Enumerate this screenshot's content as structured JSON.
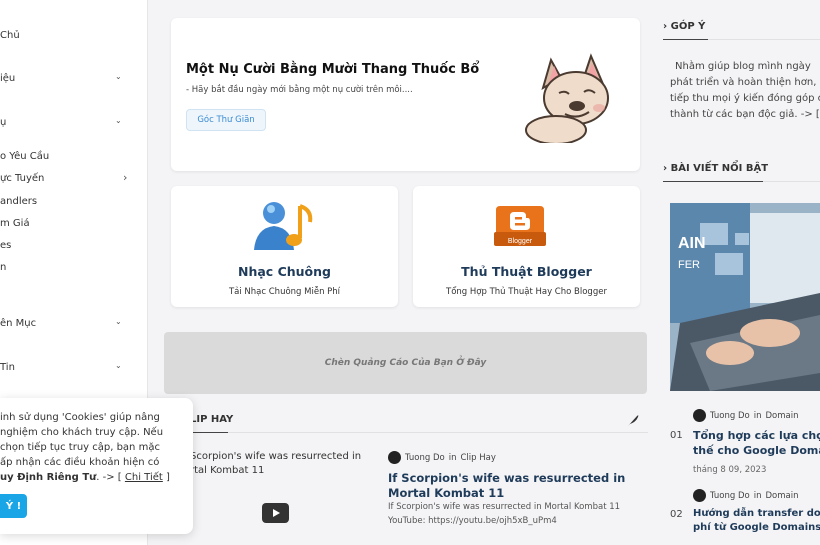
{
  "sidebar": {
    "items": [
      {
        "label": "Chủ",
        "chevron": ""
      },
      {
        "label": "iệu",
        "chevron": "⌄"
      },
      {
        "label": "ụ",
        "chevron": "⌄"
      },
      {
        "label": "o Yêu Cầu",
        "chevron": ""
      },
      {
        "label": "ực Tuyến",
        "chevron": "›"
      },
      {
        "label": "andlers",
        "chevron": ""
      },
      {
        "label": "m Giá",
        "chevron": ""
      },
      {
        "label": "es",
        "chevron": ""
      },
      {
        "label": "n",
        "chevron": ""
      },
      {
        "label": "ên Mục",
        "chevron": "⌄"
      },
      {
        "label": "Tin",
        "chevron": "⌄"
      }
    ]
  },
  "hero": {
    "title": "Một Nụ Cười Bằng Mười Thang Thuốc Bổ",
    "subtitle": "- Hãy bắt đầu ngày mới bằng một nụ cười trên môi....",
    "tag": "Góc Thư Giãn"
  },
  "features": [
    {
      "title": "Nhạc Chuông",
      "subtitle": "Tải Nhạc Chuông Miễn Phí",
      "icon": "user-music-icon"
    },
    {
      "title": "Thủ Thuật Blogger",
      "subtitle": "Tổng Hợp Thủ Thuật Hay Cho Blogger",
      "icon": "blogger-icon"
    }
  ],
  "ad": {
    "text": "Chèn Quảng Cáo Của Bạn Ở Đây"
  },
  "clip_section": {
    "heading": "LIP HAY",
    "left_post_text": [
      "Scorpion's wife was resurrected in",
      "rtal Kombat 11"
    ],
    "post": {
      "author": "Tuong Do",
      "in_word": "in",
      "category": "Clip Hay",
      "title": "If Scorpion's wife was resurrected in Mortal Kombat 11",
      "excerpt_1": "If Scorpion's wife was resurrected in Mortal Kombat 11",
      "excerpt_2": "YouTube:   https://youtu.be/ojh5xB_uPm4"
    }
  },
  "cookie": {
    "lines": [
      "inh sử dụng 'Cookies' giúp nâng",
      "nghiệm cho khách truy cập. Nếu",
      "chọn tiếp tục truy cập, bạn mặc",
      "ấp nhận các điều khoản hiện có"
    ],
    "policy_bold": "uy Định Riêng Tư",
    "policy_rest": ". -> [",
    "details_link": "Chi Tiết",
    "close_bracket": "]",
    "button": "Ý !"
  },
  "right": {
    "feedback_heading": "GÓP Ý",
    "feedback_lines": [
      "Nhằm giúp blog mình ngày",
      "phát triển và hoàn thiện hơn,",
      "tiếp thu mọi ý kiến đóng góp c",
      "thành từ các bạn độc giả. -> ["
    ],
    "featured_heading": "BÀI VIẾT NỔI BẬT",
    "image_text": "AIN\nFER",
    "posts": [
      {
        "rank": "01",
        "author": "Tuong Do",
        "in_word": "in",
        "category": "Domain",
        "title_1": "Tổng hợp các lựa chọ",
        "title_2": "thế cho Google Domai",
        "date": "tháng 8 09, 2023"
      },
      {
        "rank": "02",
        "author": "Tuong Do",
        "in_word": "in",
        "category": "Domain",
        "title_1": "Hướng dẫn transfer domai",
        "title_2": "phí từ Google Domains về"
      }
    ]
  },
  "colors": {
    "accent": "#3b8bd1",
    "title": "#1f3b5a",
    "cookie_button": "#1aa6e6",
    "orange": "#e8731a"
  }
}
